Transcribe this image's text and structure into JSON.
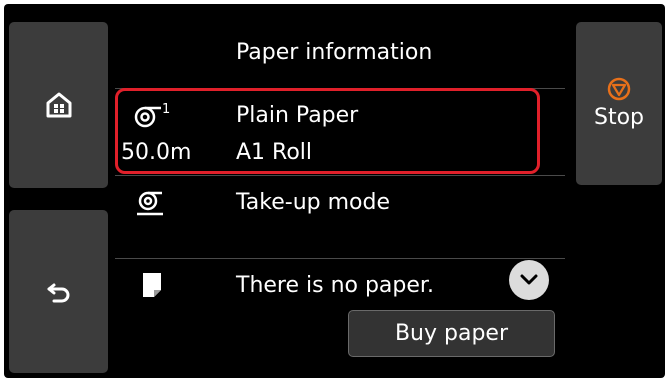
{
  "header": {
    "title": "Paper information"
  },
  "side_buttons": {
    "home_icon": "home-icon",
    "back_icon": "back-arrow-icon",
    "stop_label": "Stop",
    "stop_icon": "stop-icon"
  },
  "roll": {
    "slot": "1",
    "length": "50.0m",
    "media_type": "Plain Paper",
    "size": "A1 Roll",
    "icon": "roll-paper-icon"
  },
  "takeup": {
    "label": "Take-up mode",
    "icon": "take-up-icon"
  },
  "sheet": {
    "status": "There is no paper.",
    "icon": "cut-sheet-icon",
    "expand_icon": "chevron-down-icon",
    "buy_label": "Buy paper"
  },
  "colors": {
    "highlight": "#e0202a",
    "stop_accent": "#e8701a",
    "button_bg": "#3c3c3c"
  }
}
